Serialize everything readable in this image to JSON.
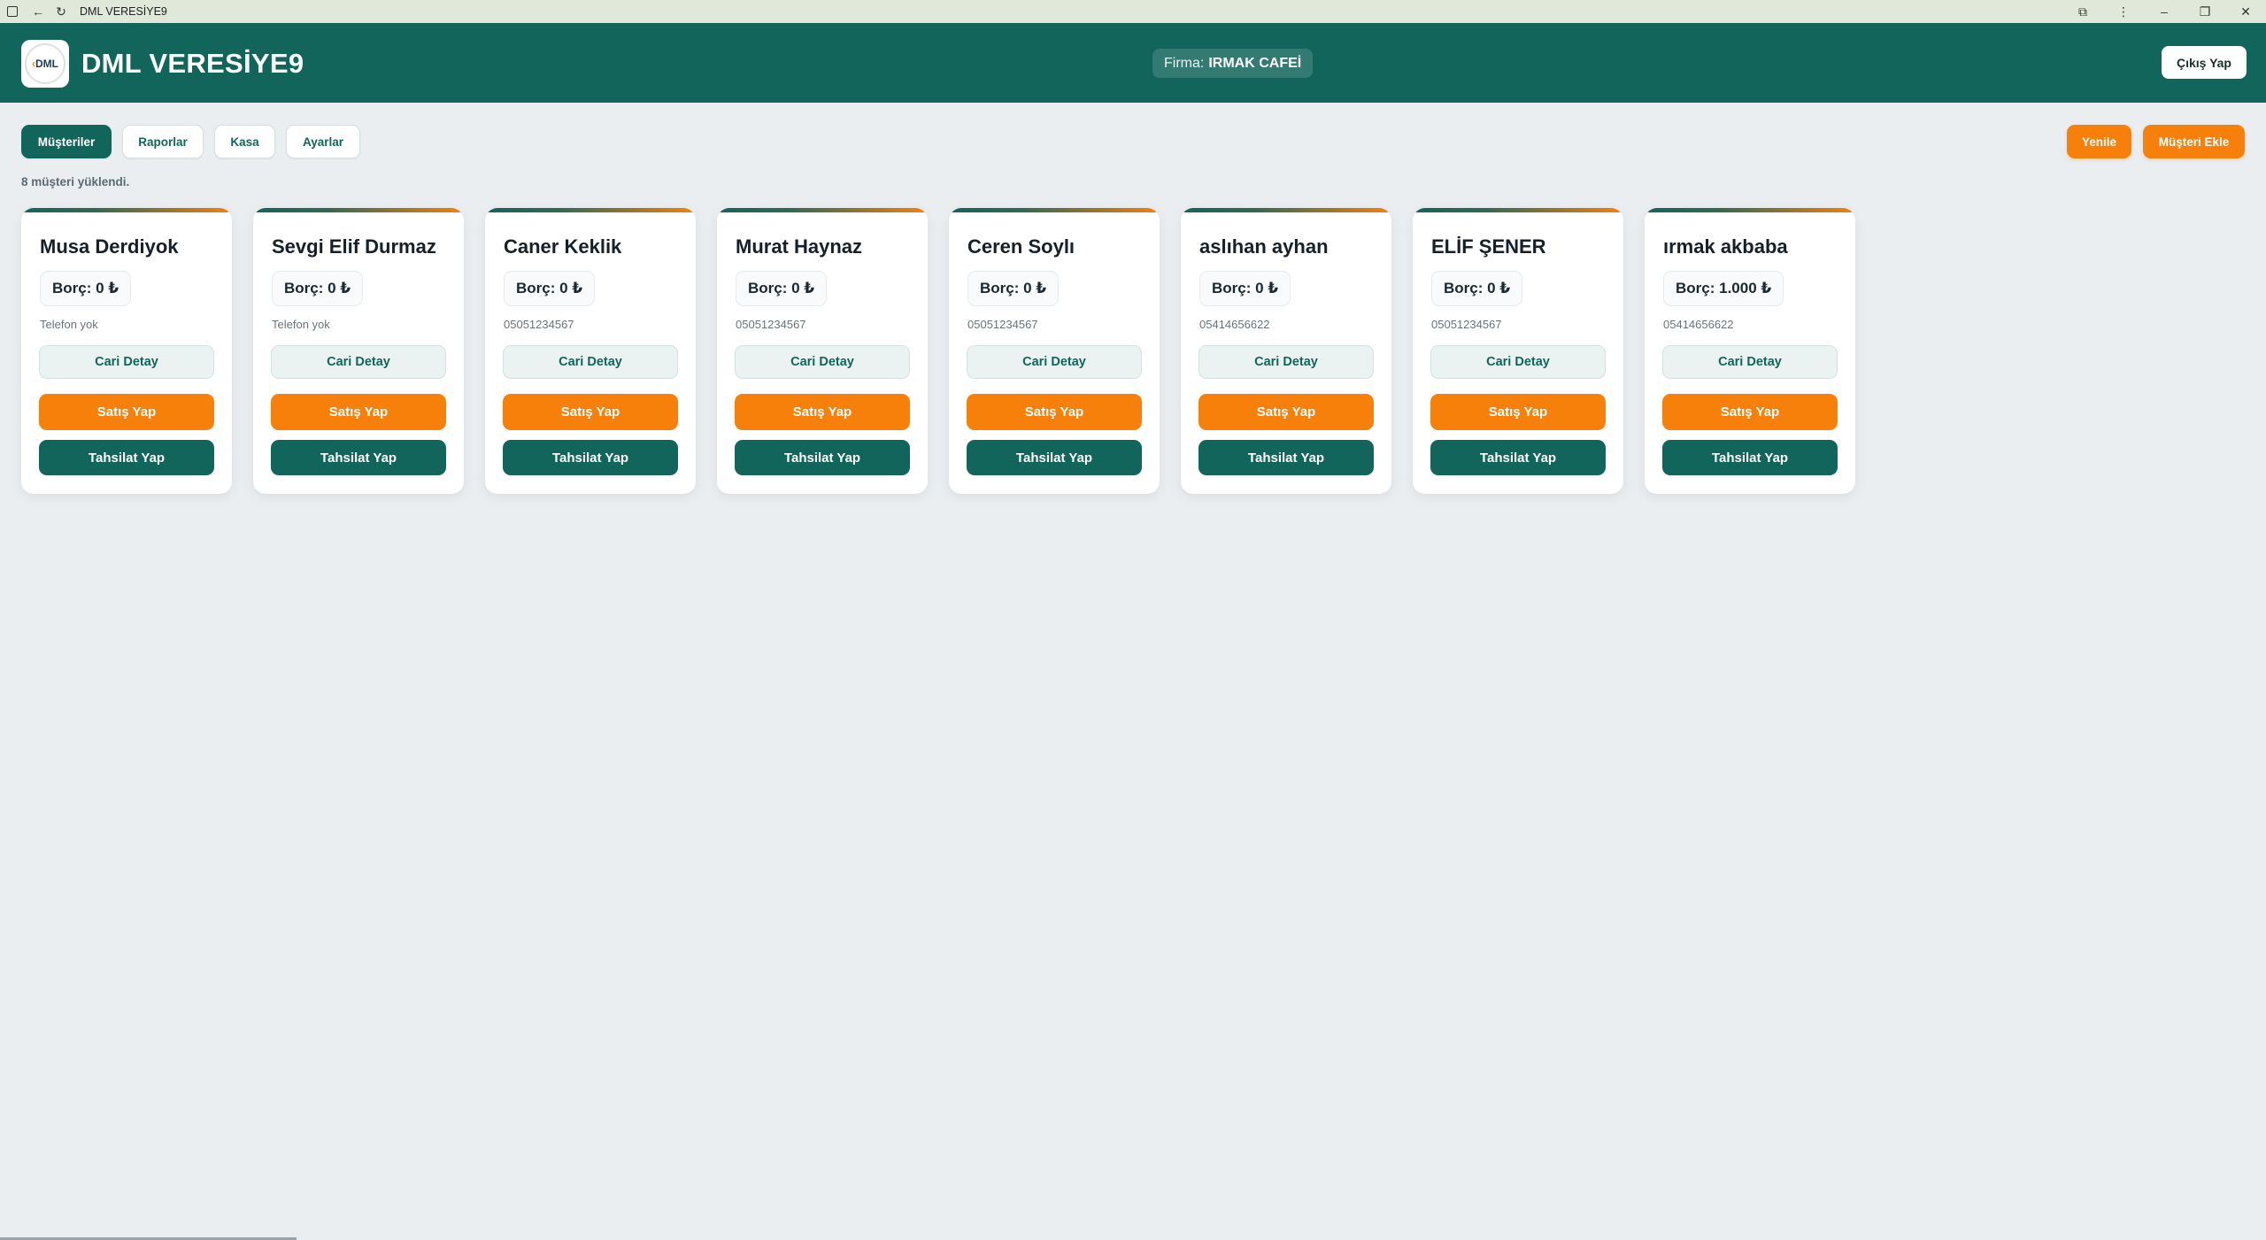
{
  "window": {
    "title": "DML VERESİYE9",
    "icons": [
      "app-icon",
      "back-arrow-icon",
      "reload-icon",
      "extensions-icon",
      "more-vertical-icon",
      "minimize-icon",
      "restore-icon",
      "close-icon"
    ]
  },
  "header": {
    "logo_text": "DML",
    "app_title": "DML VERESİYE9",
    "firm_label": "Firma:",
    "firm_name": "IRMAK CAFEİ",
    "logout_label": "Çıkış Yap"
  },
  "nav": {
    "tabs": [
      {
        "label": "Müşteriler",
        "active": true
      },
      {
        "label": "Raporlar",
        "active": false
      },
      {
        "label": "Kasa",
        "active": false
      },
      {
        "label": "Ayarlar",
        "active": false
      }
    ],
    "refresh_label": "Yenile",
    "add_customer_label": "Müşteri Ekle"
  },
  "status": "8 müşteri yüklendi.",
  "colors": {
    "primary": "#12655b",
    "accent": "#f7800b",
    "background": "#eaeef1"
  },
  "customers": [
    {
      "name": "Musa Derdiyok",
      "debt": "Borç: 0 ₺",
      "phone": "Telefon yok",
      "detail_label": "Cari Detay",
      "sale_label": "Satış Yap",
      "collect_label": "Tahsilat Yap"
    },
    {
      "name": "Sevgi Elif Durmaz",
      "debt": "Borç: 0 ₺",
      "phone": "Telefon yok",
      "detail_label": "Cari Detay",
      "sale_label": "Satış Yap",
      "collect_label": "Tahsilat Yap"
    },
    {
      "name": "Caner Keklik",
      "debt": "Borç: 0 ₺",
      "phone": "05051234567",
      "detail_label": "Cari Detay",
      "sale_label": "Satış Yap",
      "collect_label": "Tahsilat Yap"
    },
    {
      "name": "Murat Haynaz",
      "debt": "Borç: 0 ₺",
      "phone": "05051234567",
      "detail_label": "Cari Detay",
      "sale_label": "Satış Yap",
      "collect_label": "Tahsilat Yap"
    },
    {
      "name": "Ceren Soylı",
      "debt": "Borç: 0 ₺",
      "phone": "05051234567",
      "detail_label": "Cari Detay",
      "sale_label": "Satış Yap",
      "collect_label": "Tahsilat Yap"
    },
    {
      "name": "aslıhan ayhan",
      "debt": "Borç: 0 ₺",
      "phone": "05414656622",
      "detail_label": "Cari Detay",
      "sale_label": "Satış Yap",
      "collect_label": "Tahsilat Yap"
    },
    {
      "name": "ELİF ŞENER",
      "debt": "Borç: 0 ₺",
      "phone": "05051234567",
      "detail_label": "Cari Detay",
      "sale_label": "Satış Yap",
      "collect_label": "Tahsilat Yap"
    },
    {
      "name": "ırmak akbaba",
      "debt": "Borç: 1.000 ₺",
      "phone": "05414656622",
      "detail_label": "Cari Detay",
      "sale_label": "Satış Yap",
      "collect_label": "Tahsilat Yap"
    }
  ]
}
